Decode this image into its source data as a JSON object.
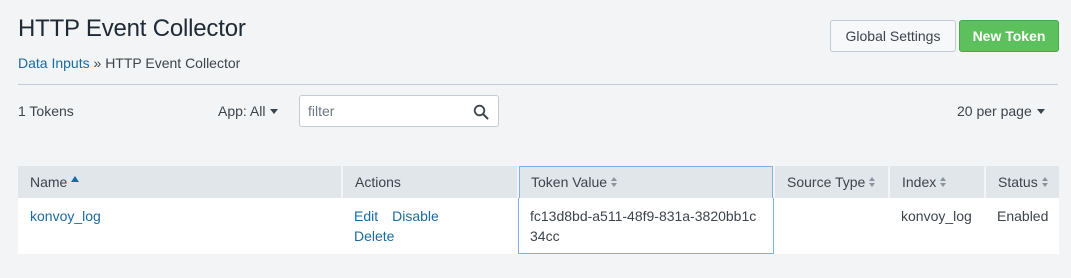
{
  "page": {
    "title": "HTTP Event Collector",
    "breadcrumb": {
      "link": "Data Inputs",
      "separator": " » ",
      "current": "HTTP Event Collector"
    }
  },
  "buttons": {
    "global_settings": "Global Settings",
    "new_token": "New Token"
  },
  "toolbar": {
    "token_count": "1 Tokens",
    "app_filter": "App: All",
    "search_placeholder": "filter",
    "search_icon": "magnifier-icon",
    "per_page": "20 per page"
  },
  "table": {
    "headers": {
      "name": "Name",
      "actions": "Actions",
      "token_value": "Token Value",
      "source_type": "Source Type",
      "index": "Index",
      "status": "Status"
    },
    "rows": [
      {
        "name": "konvoy_log",
        "actions": {
          "edit": "Edit",
          "disable": "Disable",
          "delete": "Delete"
        },
        "token_value": "fc13d8bd-a511-48f9-831a-3820bb1c34cc",
        "source_type": "",
        "index": "konvoy_log",
        "status": "Enabled"
      }
    ]
  },
  "colors": {
    "link": "#1a6ba0",
    "primary_button": "#5cc05c",
    "header_bg": "#e1e6eb",
    "page_bg": "#f2f4f5"
  }
}
